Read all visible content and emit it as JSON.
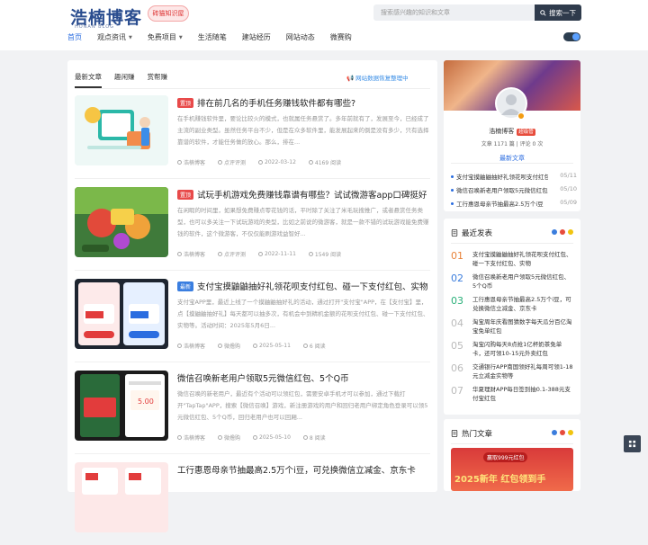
{
  "header": {
    "logo_text": "浩楠博客",
    "logo_sub": "HONAN BLOG",
    "logo_badge": "砖猫知识屋",
    "search_placeholder": "搜索感兴趣的知识和文章",
    "search_button": "搜索一下"
  },
  "nav": [
    {
      "label": "首页",
      "dropdown": false,
      "active": true
    },
    {
      "label": "观点资讯",
      "dropdown": true,
      "active": false
    },
    {
      "label": "免费项目",
      "dropdown": true,
      "active": false
    },
    {
      "label": "生活随笔",
      "dropdown": false,
      "active": false
    },
    {
      "label": "建站经历",
      "dropdown": false,
      "active": false
    },
    {
      "label": "网站动态",
      "dropdown": false,
      "active": false
    },
    {
      "label": "微赛购",
      "dropdown": false,
      "active": false
    }
  ],
  "main": {
    "tabs": [
      "最新文章",
      "趣闲赚",
      "赏帮赚"
    ],
    "notice": "网站数据恢复整理中",
    "posts": [
      {
        "tag": "置顶",
        "tag_color": "#e84a4a",
        "title": "排在前几名的手机任务赚钱软件都有哪些?",
        "desc": "在手机赚钱软件里，要论比较火的模式，也就属任务悬赏了。多年前就有了，发展至今，已经成了主流的副业类型。虽然任务平台不少，但是在众多软件里，能发展起来的倒是没有多少，只有选择靠谱的软件，才能任务做的放心。那么，排在...",
        "author": "浩楠博客",
        "category": "点评评测",
        "date": "2022-03-12",
        "views": "4169 阅读"
      },
      {
        "tag": "置顶",
        "tag_color": "#e84a4a",
        "title": "试玩手机游戏免费赚钱靠谱有哪些？试试微游客app口碑挺好",
        "desc": "在闲暇的时间里，如果想免费赚点零花钱的话，平时除了关注了米毛玩搜推广，或者悬赏任务类型，也可以多关注一下试玩游戏的类型，比如之前说的微游客，就是一款不错的试玩游戏能免费赚钱的软件，这个微游客，不仅仅能刷游戏益智好...",
        "author": "浩楠博客",
        "category": "点评评测",
        "date": "2022-11-11",
        "views": "1549 阅读"
      },
      {
        "tag": "最新",
        "tag_color": "#3a7ee0",
        "title": "支付宝摸鼬鼬抽好礼领花呗支付红包、碰一下支付红包、实物",
        "desc": "支付宝APP里，最近上线了一个摸鼬鼬抽好礼的活动，通过打开\"支付宝\"APP，在【支付宝】里，点【摸鼬鼬抽好礼】每天都可以抽多次，有机会中到精机金额的花呗支付红包、碰一下支付红包、实物等。活动时间：2025年5月6日...",
        "author": "浩楠博客",
        "category": "微撸购",
        "date": "2025-05-11",
        "views": "6 阅读"
      },
      {
        "tag": "",
        "tag_color": "",
        "title": "微信召唤新老用户领取5元微信红包、5个Q币",
        "desc": "微信召唤的新老用户，最近有个活动可以领红包，需要安卓手机才可以参加，通过下载打开\"TapTap\"APP，搜索【微信召唤】游戏，新注册游戏的用户和回归老用户绑定角色登录可以领5元微信红包、5个Q币，回归老用户也可以回厢...",
        "author": "浩楠博客",
        "category": "微撸购",
        "date": "2025-05-10",
        "views": "8 阅读"
      },
      {
        "tag": "",
        "tag_color": "",
        "title": "工行惠恩母亲节抽最高2.5万个i豆，可兑换微信立减金、京东卡",
        "desc": "",
        "author": "",
        "category": "",
        "date": "",
        "views": ""
      }
    ]
  },
  "profile": {
    "name": "浩楠博客",
    "level": "超级管",
    "stats": "文章 1171 篇 | 评论 0 次",
    "latest_label": "最新文章",
    "latest": [
      {
        "title": "支付宝摸鼬鼬抽好礼领花呗支付红包",
        "date": "05/11"
      },
      {
        "title": "微信召唤新老用户领取5元微信红包",
        "date": "05/10"
      },
      {
        "title": "工行惠恩母亲节抽最高2.5万个i豆",
        "date": "05/09"
      }
    ]
  },
  "recent": {
    "title": "最近发表",
    "dots": [
      "#3b7ddd",
      "#e74c3c",
      "#f1c40f"
    ],
    "items": [
      {
        "num": "01",
        "text": "支付宝摸鼬鼬抽好礼领花呗支付红包、碰一下支付红包、实物"
      },
      {
        "num": "02",
        "text": "微信召唤新老用户领取5元微信红包、5个Q币"
      },
      {
        "num": "03",
        "text": "工行惠恩母亲节抽最高2.5万个i豆，可兑换微信立减金、京东卡"
      },
      {
        "num": "04",
        "text": "淘宝周年庆看图猜数字每天瓜分百亿淘宝免单红包"
      },
      {
        "num": "05",
        "text": "淘宝闪购每天8点抢1亿杯奶茶免单卡，还可领10-15元外卖红包"
      },
      {
        "num": "06",
        "text": "交通银行APP南国领好礼每周可领1-18元立减金实物等"
      },
      {
        "num": "07",
        "text": "华夏理财APP每日签到抽0.1-388元支付宝红包"
      }
    ]
  },
  "hot": {
    "title": "热门文章",
    "banner": "赢取999元红包",
    "big": "2025新年 红包领到手"
  }
}
